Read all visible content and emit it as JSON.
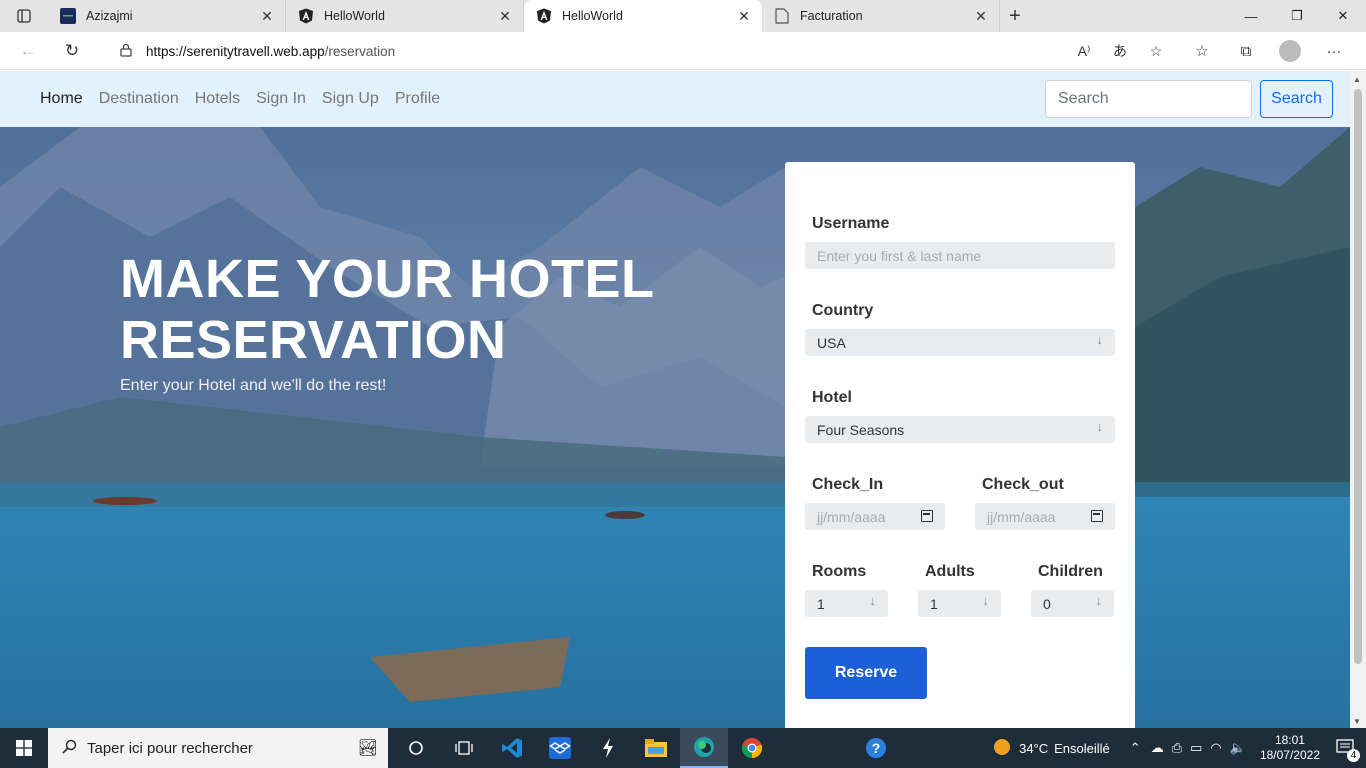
{
  "browser": {
    "tabs": [
      {
        "title": "Azizajmi",
        "favicon": "site-icon"
      },
      {
        "title": "HelloWorld",
        "favicon": "angular-icon"
      },
      {
        "title": "HelloWorld",
        "favicon": "angular-icon",
        "active": true
      },
      {
        "title": "Facturation",
        "favicon": "document-icon"
      }
    ],
    "url_host": "https://serenitytravell.web.app",
    "url_path": "/reservation"
  },
  "navbar": {
    "links": [
      "Home",
      "Destination",
      "Hotels",
      "Sign In",
      "Sign Up",
      "Profile"
    ],
    "search_placeholder": "Search",
    "search_button": "Search"
  },
  "hero": {
    "title_line1": "MAKE YOUR HOTEL",
    "title_line2": "RESERVATION",
    "subtitle": "Enter your Hotel and we'll do the rest!"
  },
  "form": {
    "username_label": "Username",
    "username_placeholder": "Enter you first & last name",
    "country_label": "Country",
    "country_value": "USA",
    "hotel_label": "Hotel",
    "hotel_value": "Four Seasons",
    "checkin_label": "Check_In",
    "checkout_label": "Check_out",
    "date_placeholder": "jj/mm/aaaa",
    "rooms_label": "Rooms",
    "rooms_value": "1",
    "adults_label": "Adults",
    "adults_value": "1",
    "children_label": "Children",
    "children_value": "0",
    "reserve_button": "Reserve"
  },
  "taskbar": {
    "search_placeholder": "Taper ici pour rechercher",
    "weather_temp": "34°C",
    "weather_text": "Ensoleillé",
    "time": "18:01",
    "date": "18/07/2022",
    "notification_count": "4"
  },
  "colors": {
    "accent": "#1c5fd6",
    "navbar_bg": "#e3f1fd",
    "search_button": "#0d6efd"
  }
}
